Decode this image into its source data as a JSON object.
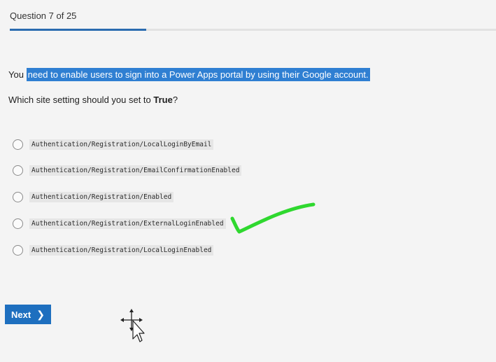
{
  "header": {
    "progress_label": "Question 7 of 25",
    "progress_fraction": 0.28
  },
  "question": {
    "lead": "You",
    "highlighted": "need to enable users to sign into a Power Apps portal by using their Google account.",
    "prompt_before": "Which site setting should you set to ",
    "prompt_bold": "True",
    "prompt_after": "?"
  },
  "options": [
    {
      "label": "Authentication/Registration/LocalLoginByEmail",
      "selected": false
    },
    {
      "label": "Authentication/Registration/EmailConfirmationEnabled",
      "selected": false
    },
    {
      "label": "Authentication/Registration/Enabled",
      "selected": false
    },
    {
      "label": "Authentication/Registration/ExternalLoginEnabled",
      "selected": false
    },
    {
      "label": "Authentication/Registration/LocalLoginEnabled",
      "selected": false
    }
  ],
  "footer": {
    "next_label": "Next",
    "next_icon": "chevron-right-icon"
  },
  "annotation": {
    "icon": "checkmark-icon",
    "color": "#2fd82f",
    "marks_option": 3
  },
  "colors": {
    "accent": "#1e6fbf",
    "highlight": "#2f7fd2"
  }
}
